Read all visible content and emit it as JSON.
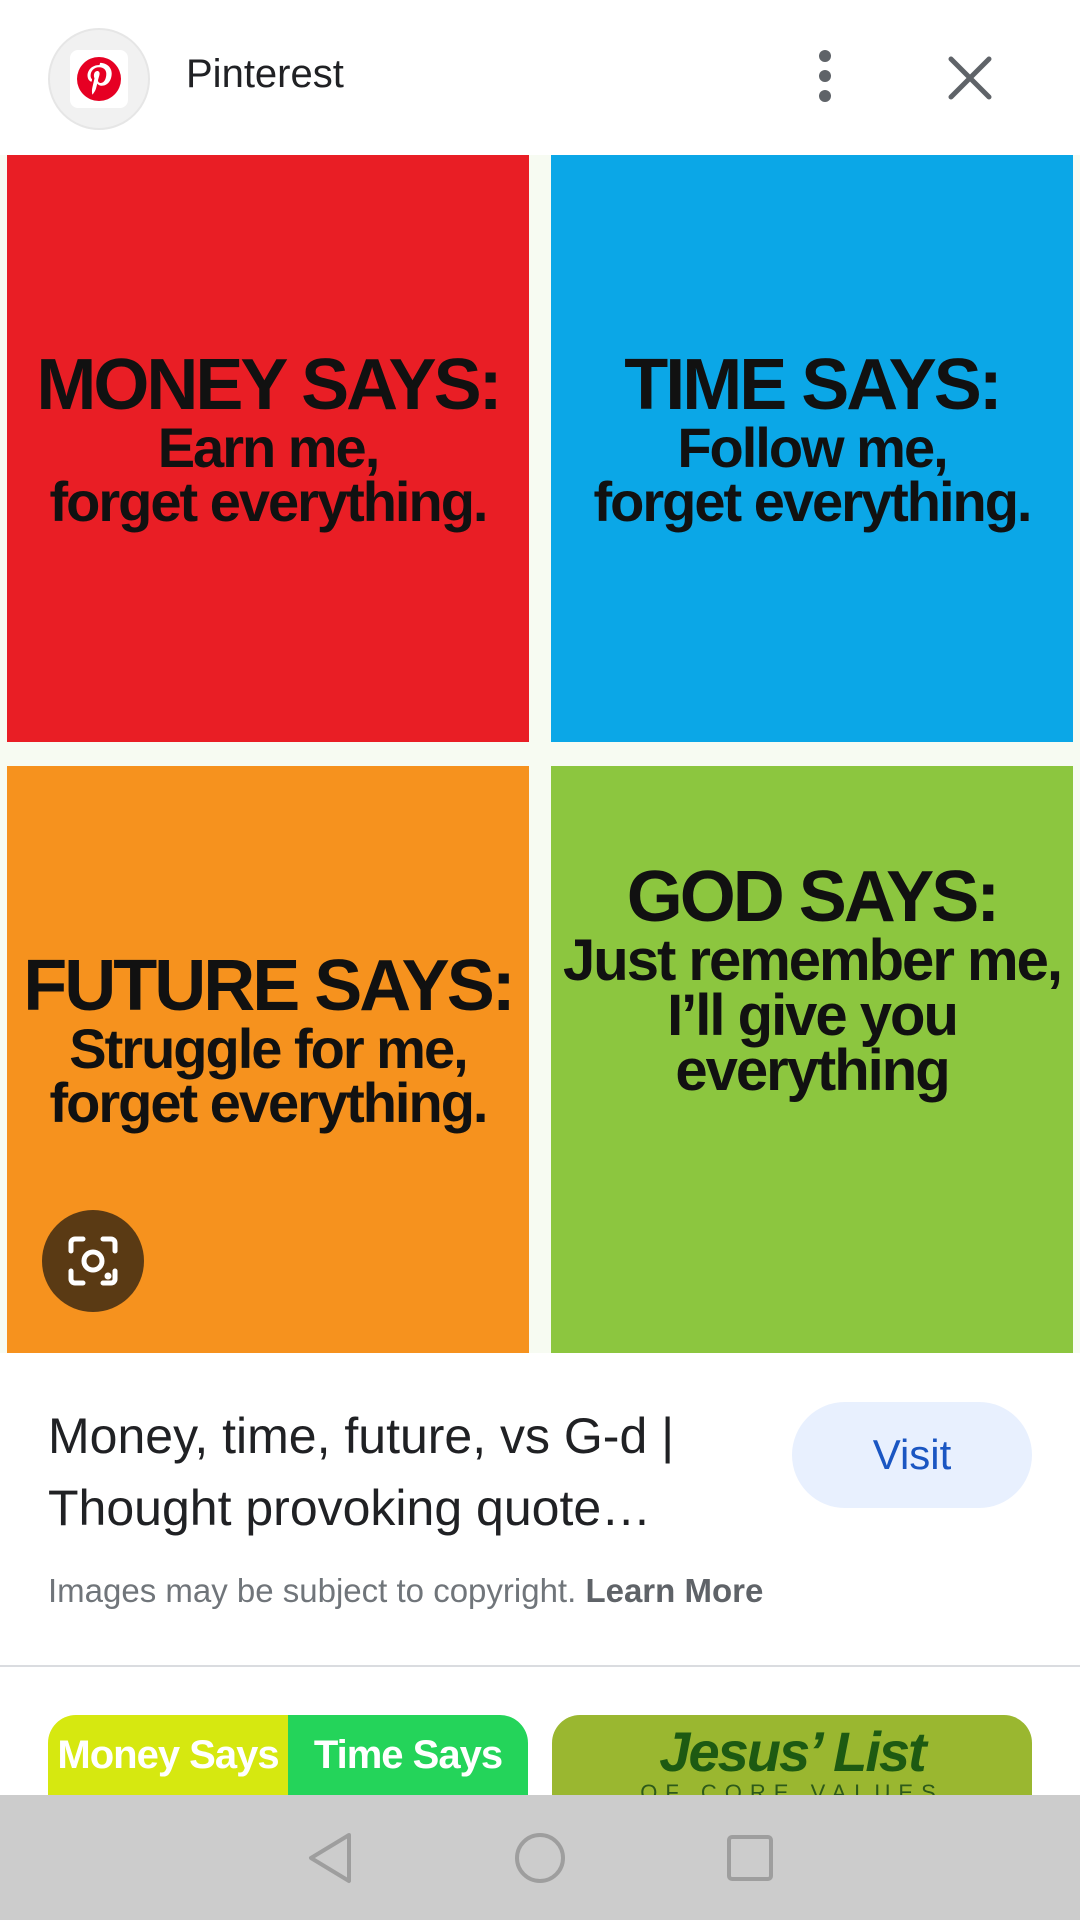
{
  "header": {
    "site_name": "Pinterest",
    "logo_icon": "pinterest-logo",
    "brand_color": "#e60023",
    "menu_icon": "more-vert-icon",
    "close_icon": "close-icon"
  },
  "image": {
    "quadrants": [
      {
        "heading": "MONEY SAYS:",
        "lines": [
          "Earn me,",
          "forget everything."
        ],
        "color": "#e91e25"
      },
      {
        "heading": "TIME SAYS:",
        "lines": [
          "Follow me,",
          "forget everything."
        ],
        "color": "#0ba7e7"
      },
      {
        "heading": "FUTURE SAYS:",
        "lines": [
          "Struggle for me,",
          "forget everything."
        ],
        "color": "#f6921e"
      },
      {
        "heading": "GOD SAYS:",
        "lines": [
          "Just remember me,",
          "I’ll give you",
          "everything"
        ],
        "color": "#8cc63f"
      }
    ],
    "lens_icon": "google-lens-icon"
  },
  "info": {
    "title": "Money, time, future, vs G-d | Thought provoking quote…",
    "visit_label": "Visit",
    "copyright_text": "Images may be subject to copyright.",
    "learn_more": "Learn More"
  },
  "related": [
    {
      "left_text": "Money Says",
      "right_text": "Time Says"
    },
    {
      "title": "Jesus’ List",
      "subtitle": "OF CORE VALUES"
    }
  ],
  "navbar": {
    "back_icon": "back-triangle-icon",
    "home_icon": "home-circle-icon",
    "recents_icon": "recents-square-icon"
  }
}
